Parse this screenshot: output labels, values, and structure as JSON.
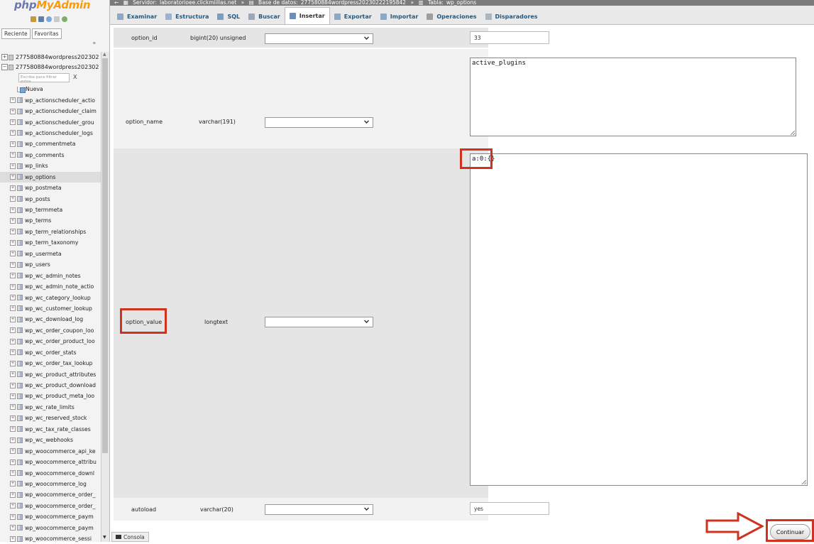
{
  "logo": {
    "php": "php",
    "myadmin": "MyAdmin"
  },
  "nav": {
    "tabs": [
      "Reciente",
      "Favoritas"
    ],
    "databases": [
      "277580884wordpress202302",
      "277580884wordpress202302"
    ],
    "filter_placeholder": "Escribe para filtrar estos",
    "filter_clear": "X",
    "new_label": "Nueva",
    "tables": [
      "wp_actionscheduler_actio",
      "wp_actionscheduler_claim",
      "wp_actionscheduler_grou",
      "wp_actionscheduler_logs",
      "wp_commentmeta",
      "wp_comments",
      "wp_links",
      "wp_options",
      "wp_postmeta",
      "wp_posts",
      "wp_termmeta",
      "wp_terms",
      "wp_term_relationships",
      "wp_term_taxonomy",
      "wp_usermeta",
      "wp_users",
      "wp_wc_admin_notes",
      "wp_wc_admin_note_actio",
      "wp_wc_category_lookup",
      "wp_wc_customer_lookup",
      "wp_wc_download_log",
      "wp_wc_order_coupon_loo",
      "wp_wc_order_product_loo",
      "wp_wc_order_stats",
      "wp_wc_order_tax_lookup",
      "wp_wc_product_attributes",
      "wp_wc_product_download",
      "wp_wc_product_meta_loo",
      "wp_wc_rate_limits",
      "wp_wc_reserved_stock",
      "wp_wc_tax_rate_classes",
      "wp_wc_webhooks",
      "wp_woocommerce_api_ke",
      "wp_woocommerce_attribu",
      "wp_woocommerce_downl",
      "wp_woocommerce_log",
      "wp_woocommerce_order_",
      "wp_woocommerce_order_",
      "wp_woocommerce_paym",
      "wp_woocommerce_paym",
      "wp_woocommerce_sessi"
    ],
    "active_table": "wp_options"
  },
  "breadcrumb": {
    "server_label": "Servidor:",
    "server": "laboratorioee.clickmiillas.net",
    "sep1": "»",
    "db_label": "Base de datos:",
    "db": "277580884wordpress20230222195842",
    "sep2": "»",
    "table_label": "Tabla:",
    "table": "wp_options"
  },
  "tabs": [
    {
      "label": "Examinar",
      "icon": "browse-icon",
      "color": "#8aa9c9"
    },
    {
      "label": "Estructura",
      "icon": "structure-icon",
      "color": "#9bb3d1"
    },
    {
      "label": "SQL",
      "icon": "sql-icon",
      "color": "#7c9cc0"
    },
    {
      "label": "Buscar",
      "icon": "search-icon",
      "color": "#9aa9b8"
    },
    {
      "label": "Insertar",
      "icon": "insert-icon",
      "color": "#6d8fb5"
    },
    {
      "label": "Exportar",
      "icon": "export-icon",
      "color": "#8aa9c9"
    },
    {
      "label": "Importar",
      "icon": "import-icon",
      "color": "#8aa9c9"
    },
    {
      "label": "Operaciones",
      "icon": "wrench-icon",
      "color": "#9e9e9e"
    },
    {
      "label": "Disparadores",
      "icon": "triggers-icon",
      "color": "#aab5c0"
    }
  ],
  "active_tab": "Insertar",
  "rows": {
    "option_id": {
      "name": "option_id",
      "type": "bigint(20) unsigned",
      "value": "33"
    },
    "option_name": {
      "name": "option_name",
      "type": "varchar(191)",
      "value": "active_plugins"
    },
    "option_value": {
      "name": "option_value",
      "type": "longtext",
      "value": "a:0:{}"
    },
    "autoload": {
      "name": "autoload",
      "type": "varchar(20)",
      "value": "yes"
    }
  },
  "console_label": "Consola",
  "submit_label": "Continuar",
  "colors": {
    "highlight": "#d0321f",
    "link": "#235a81",
    "logo_php": "#6c78af",
    "logo_myadmin": "#f89c0e"
  }
}
